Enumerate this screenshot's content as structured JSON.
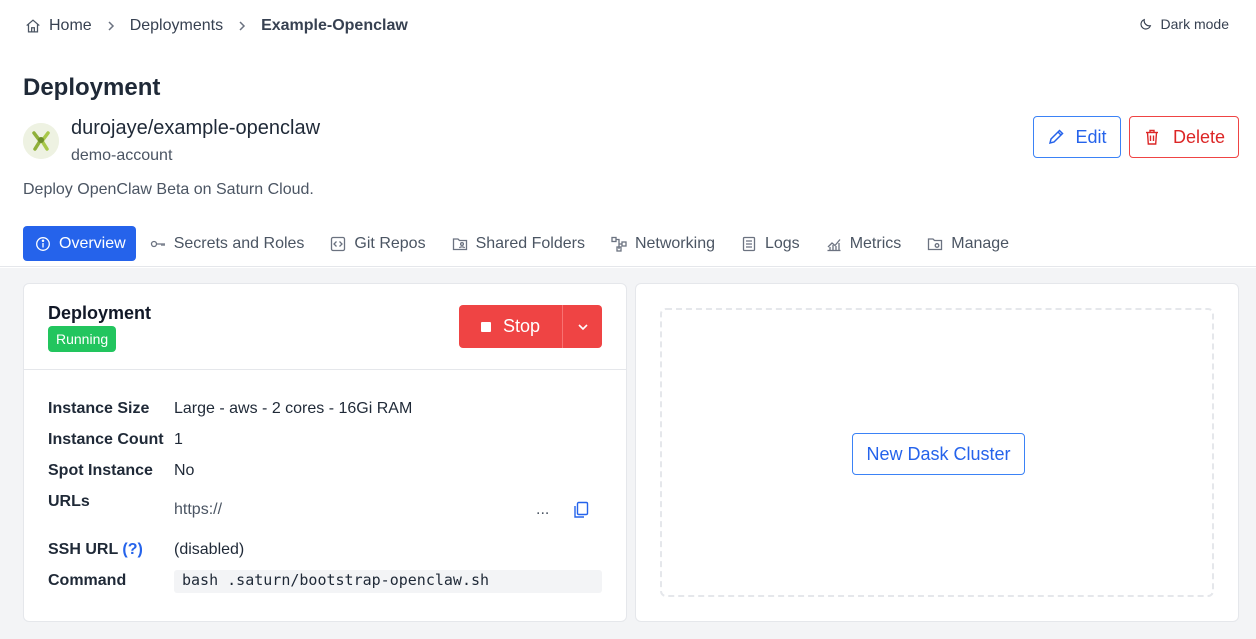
{
  "breadcrumb": {
    "home": "Home",
    "deployments": "Deployments",
    "current": "Example-Openclaw"
  },
  "header": {
    "dark_mode_label": "Dark mode",
    "page_title": "Deployment",
    "repo_name": "durojaye/example-openclaw",
    "owner": "demo-account",
    "description": "Deploy OpenClaw Beta on Saturn Cloud.",
    "edit_label": "Edit",
    "delete_label": "Delete"
  },
  "tabs": [
    {
      "label": "Overview",
      "icon": "info-icon",
      "active": true
    },
    {
      "label": "Secrets and Roles",
      "icon": "key-icon"
    },
    {
      "label": "Git Repos",
      "icon": "code-icon"
    },
    {
      "label": "Shared Folders",
      "icon": "folder-user-icon"
    },
    {
      "label": "Networking",
      "icon": "network-icon"
    },
    {
      "label": "Logs",
      "icon": "document-icon"
    },
    {
      "label": "Metrics",
      "icon": "chart-icon"
    },
    {
      "label": "Manage",
      "icon": "folder-gear-icon"
    }
  ],
  "deployment_card": {
    "title": "Deployment",
    "status": "Running",
    "stop_label": "Stop",
    "rows": {
      "instance_size_label": "Instance Size",
      "instance_size_value": "Large - aws - 2 cores - 16Gi RAM",
      "instance_count_label": "Instance Count",
      "instance_count_value": "1",
      "spot_label": "Spot Instance",
      "spot_value": "No",
      "urls_label": "URLs",
      "url_value": "https://",
      "url_truncation": "...",
      "ssh_label": "SSH URL",
      "ssh_help": "(?)",
      "ssh_value": "(disabled)",
      "command_label": "Command",
      "command_value": "bash .saturn/bootstrap-openclaw.sh"
    }
  },
  "dask_card": {
    "button_label": "New Dask Cluster"
  },
  "colors": {
    "primary": "#2563eb",
    "danger": "#ef4444",
    "success": "#22c55e",
    "background": "#f3f4f6"
  }
}
